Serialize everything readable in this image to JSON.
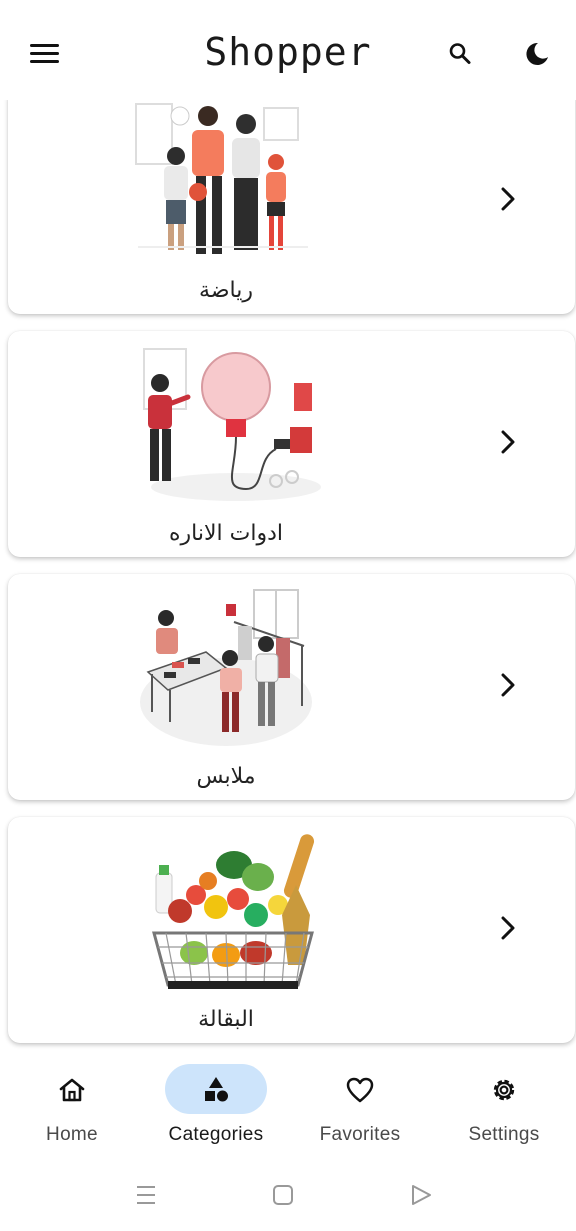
{
  "app": {
    "title": "Shopper"
  },
  "categories": [
    {
      "label": "رياضة",
      "image": "family-sports-illustration"
    },
    {
      "label": "ادوات  الاناره",
      "image": "light-bulb-illustration"
    },
    {
      "label": "ملابس",
      "image": "clothing-store-illustration"
    },
    {
      "label": "البقالة",
      "image": "grocery-basket-photo"
    }
  ],
  "bottom_nav": {
    "items": [
      {
        "label": "Home",
        "icon": "home-icon",
        "active": false
      },
      {
        "label": "Categories",
        "icon": "shapes-icon",
        "active": true
      },
      {
        "label": "Favorites",
        "icon": "heart-icon",
        "active": false
      },
      {
        "label": "Settings",
        "icon": "gear-icon",
        "active": false
      }
    ]
  },
  "colors": {
    "active_indicator": "#cde4fb",
    "text": "#111111"
  }
}
